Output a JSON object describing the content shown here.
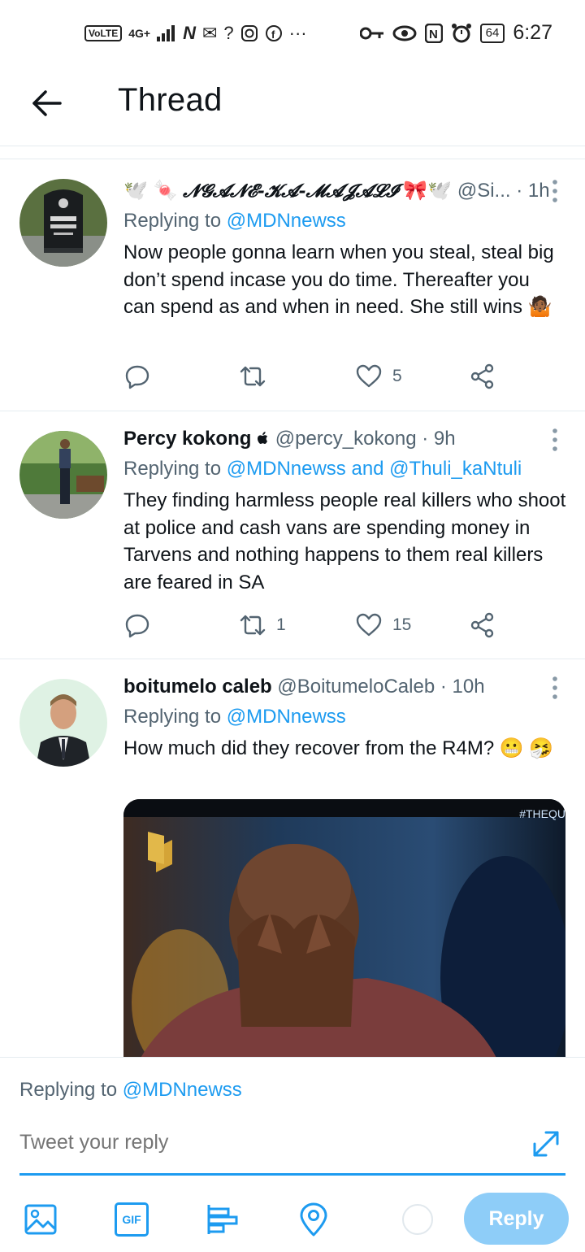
{
  "status_bar": {
    "left_items": [
      "VoLTE",
      "4G+",
      "N",
      "✉",
      "?",
      "ig",
      "f",
      "···"
    ],
    "battery": "64",
    "time": "6:27"
  },
  "header": {
    "title": "Thread"
  },
  "tweets": [
    {
      "display_name": "𝓝𝓖𝓐𝓝𝓔-𝓚𝓐-𝓜𝓐𝓙𝓐𝓛𝓘",
      "name_prefix": "🕊️ 🍬",
      "name_suffix": "🎀🕊️",
      "handle": "@Si...",
      "time": "· 1h",
      "replying_label": "Replying to",
      "replying_to": "@MDNnewss",
      "text": "Now people gonna learn when you steal, steal big don’t spend incase you do time. Thereafter you can spend as and when in need. She still wins 🤷🏾",
      "retweets": "",
      "likes": "5"
    },
    {
      "display_name": "Percy kokong",
      "name_suffix": "",
      "handle": "@percy_kokong",
      "time": "· 9h",
      "replying_label": "Replying to",
      "replying_to": "@MDNnewss and @Thuli_kaNtuli",
      "text": "They finding harmless people real killers who shoot at police and cash vans are spending money in Tarvens and nothing happens to them real killers are feared in SA",
      "retweets": "1",
      "likes": "15"
    },
    {
      "display_name": "boitumelo caleb",
      "handle": "@BoitumeloCaleb",
      "time": "· 10h",
      "replying_label": "Replying to",
      "replying_to": "@MDNnewss",
      "text": "How much did they recover from the R4M? 😬 🤧",
      "media_tag": "#THEQU"
    }
  ],
  "composer": {
    "replying_label": "Replying to",
    "replying_to": "@MDNnewss",
    "placeholder": "Tweet your reply",
    "reply_button": "Reply",
    "gif_label": "GIF"
  },
  "colors": {
    "accent": "#1d9bf0",
    "reply_button_disabled": "#8ecdf8",
    "secondary_text": "#536471"
  }
}
